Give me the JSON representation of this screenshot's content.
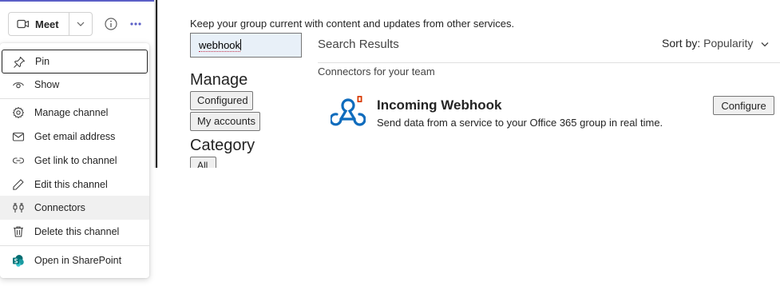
{
  "header": {
    "meet_label": "Meet",
    "accent_color": "#5b5fc7"
  },
  "menu": {
    "items": [
      {
        "label": "Pin",
        "icon": "pin-icon"
      },
      {
        "label": "Show",
        "icon": "eye-icon"
      },
      {
        "label": "Manage channel",
        "icon": "gear-icon"
      },
      {
        "label": "Get email address",
        "icon": "mail-icon"
      },
      {
        "label": "Get link to channel",
        "icon": "link-icon"
      },
      {
        "label": "Edit this channel",
        "icon": "pencil-icon"
      },
      {
        "label": "Connectors",
        "icon": "connector-icon"
      },
      {
        "label": "Delete this channel",
        "icon": "trash-icon"
      },
      {
        "label": "Open in SharePoint",
        "icon": "sharepoint-icon"
      }
    ]
  },
  "connectors": {
    "intro": "Keep your group current with content and updates from other services.",
    "search_value": "webhook",
    "manage_heading": "Manage",
    "configured_label": "Configured",
    "my_accounts_label": "My accounts",
    "category_heading": "Category",
    "all_label": "All",
    "results_title": "Search Results",
    "sort_label": "Sort by:",
    "sort_value": "Popularity",
    "section_title": "Connectors for your team",
    "items": [
      {
        "name": "Incoming Webhook",
        "description": "Send data from a service to your Office 365 group in real time.",
        "action_label": "Configure"
      }
    ]
  }
}
